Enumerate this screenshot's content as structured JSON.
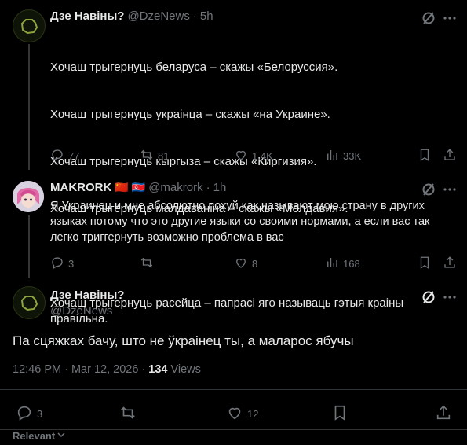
{
  "tweet1": {
    "name": "Дзе Навіны?",
    "handle": "@DzeNews",
    "sep": "·",
    "time": "5h",
    "lines": [
      "Хочаш трыгернуць беларуса – скажы «Белоруссия».",
      "Хочаш трыгернуць украінца – скажы «на Украине».",
      "Хочаш трыгернуць кыргыза – скажы «Киргизия».",
      "Хочаш трыгернуць малдаваніна – скажы «Молдавия».",
      "",
      "Хочаш трыгернуць расейца – папрасі яго называць гэтыя краіны правільна."
    ],
    "replies": "77",
    "reposts": "81",
    "likes": "1.4K",
    "views": "33K"
  },
  "tweet2": {
    "name": "MAKRORK",
    "flags": [
      "🇨🇳",
      "🇰🇵"
    ],
    "handle": "@makrork",
    "sep": "·",
    "time": "1h",
    "text": "Я Украинец и мне абсолютно похуй как называют мою страну в других языках потому что это другие языки со своими нормами, а если вас так легко триггернуть возможно проблема в вас",
    "replies": "3",
    "reposts": "",
    "likes": "8",
    "views": "168"
  },
  "tweet3": {
    "name": "Дзе Навіны?",
    "handle": "@DzeNews",
    "text": "Па сцяжках бачу, што не ўкраінец ты, а маларос ябучы",
    "timestamp": "12:46 PM · Mar 12, 2026 ·",
    "views_count": "134",
    "views_label": "Views",
    "replies": "3",
    "reposts": "",
    "likes": "12"
  },
  "footer": {
    "relevant": "Relevant"
  },
  "icons": [
    "grok-icon",
    "more-icon",
    "reply-icon",
    "repost-icon",
    "like-icon",
    "views-icon",
    "bookmark-icon",
    "share-icon",
    "chevron-down-icon"
  ],
  "colors": {
    "background": "#000000",
    "text": "#e7e9ea",
    "muted": "#71767b",
    "avatar_green": "#3b4a1e"
  }
}
